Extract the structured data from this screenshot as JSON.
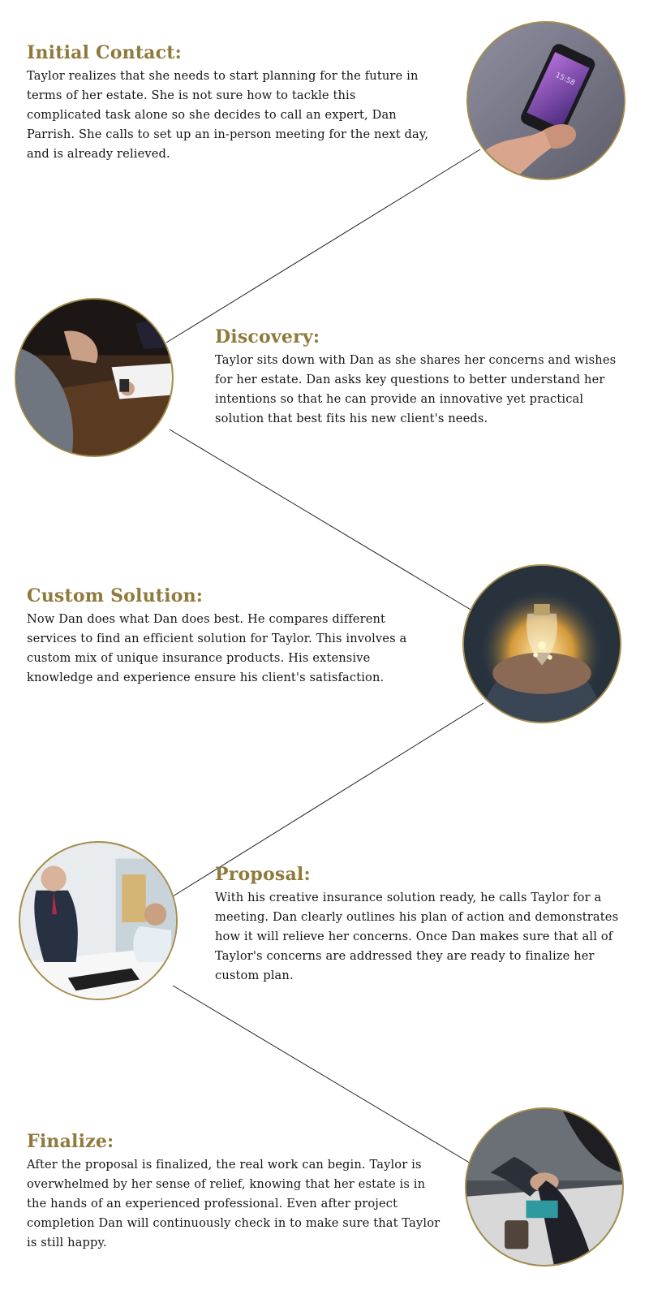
{
  "steps": [
    {
      "title": "Initial Contact:",
      "body": "Taylor realizes that she needs to start planning for the future in terms of her estate. She is not sure how to tackle this complicated task alone so she decides to call an expert, Dan Parrish. She calls to set up an in-person meeting for the next day, and is already relieved.",
      "image": "hand-holding-smartphone-photo"
    },
    {
      "title": "Discovery:",
      "body": "Taylor sits down with Dan as she shares her concerns and wishes for her estate. Dan asks key questions to better understand her intentions so that he can provide an innovative yet practical solution that best fits his new client's needs.",
      "image": "meeting-at-desk-photo"
    },
    {
      "title": "Custom Solution:",
      "body": "Now Dan does what Dan does best. He compares different services to find an efficient solution for Taylor. This involves a custom mix of unique insurance products. His extensive knowledge and experience ensure his client's satisfaction.",
      "image": "hands-holding-lightbulb-photo"
    },
    {
      "title": "Proposal:",
      "body": "With his creative insurance solution ready, he calls Taylor for a meeting. Dan clearly outlines his plan of action and demonstrates how it will relieve her concerns. Once Dan makes sure that all of Taylor's concerns are addressed they are ready to finalize her custom plan.",
      "image": "office-presentation-photo"
    },
    {
      "title": "Finalize:",
      "body": "After the proposal is finalized, the real work can begin. Taylor is overwhelmed by her sense of relief, knowing that her estate is in the hands of an experienced professional. Even after project completion Dan will continuously check in to make sure that Taylor is still happy.",
      "image": "handshake-photo"
    }
  ],
  "colors": {
    "heading": "#8f7a3c",
    "ring": "#a58e4c",
    "text": "#151515",
    "connector": "#222222"
  }
}
